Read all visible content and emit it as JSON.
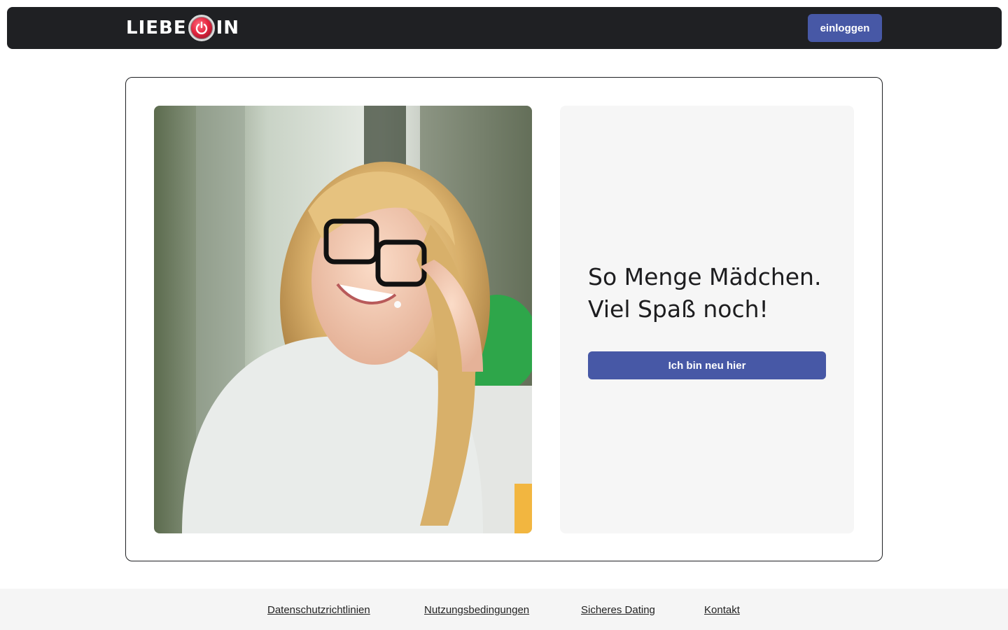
{
  "header": {
    "logo_left": "LIEBE",
    "logo_right": "IN",
    "logo_icon": "power-heart-icon",
    "login_label": "einloggen"
  },
  "hero": {
    "photo_alt": "woman-with-glasses-photo",
    "headline_line1": "So Menge Mädchen.",
    "headline_line2": "Viel Spaß noch!",
    "signup_label": "Ich bin neu hier"
  },
  "footer": {
    "links": [
      {
        "label": "Datenschutzrichtlinien"
      },
      {
        "label": "Nutzungsbedingungen"
      },
      {
        "label": "Sicheres Dating"
      },
      {
        "label": "Kontakt"
      }
    ]
  },
  "colors": {
    "header_bg": "#1f2023",
    "accent": "#4758a6",
    "logo_red": "#e3263f",
    "panel_bg": "#f6f6f6",
    "footer_bg": "#f5f5f5"
  }
}
